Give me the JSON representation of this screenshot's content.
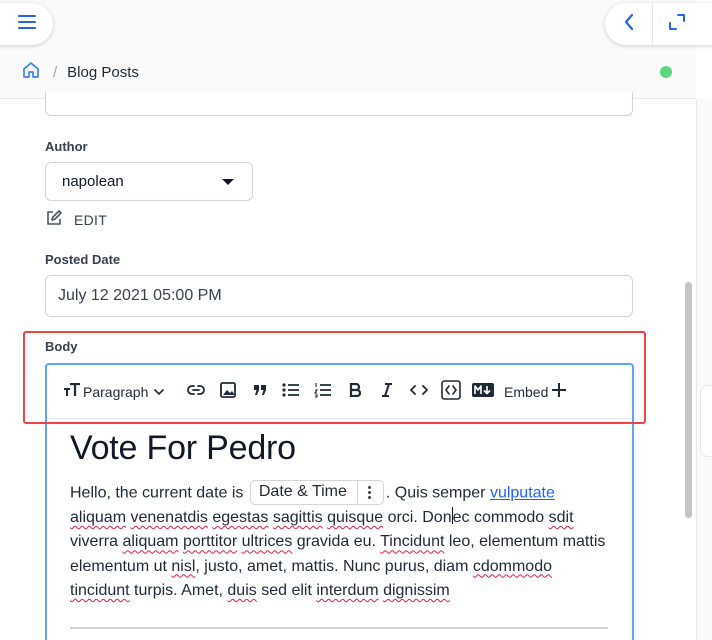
{
  "header": {
    "breadcrumb_separator": "/",
    "breadcrumb_current": "Blog Posts",
    "status_color": "#5ed67f"
  },
  "icons": {
    "menu": "hamburger-icon",
    "back": "chevron-left-icon",
    "expand": "expand-icon",
    "home": "home-icon",
    "edit": "pencil-square-icon"
  },
  "form": {
    "author": {
      "label": "Author",
      "value": "napolean",
      "edit_label": "EDIT"
    },
    "posted_date": {
      "label": "Posted Date",
      "value": "July 12 2021 05:00 PM"
    },
    "body": {
      "label": "Body"
    }
  },
  "editor": {
    "toolbar": {
      "paragraph_label": "Paragraph",
      "embed_label": "Embed",
      "buttons": [
        "text-style",
        "link",
        "image",
        "quote",
        "bulleted-list",
        "numbered-list",
        "bold",
        "italic",
        "code",
        "code-block",
        "markdown"
      ]
    },
    "content": {
      "heading": "Vote For Pedro",
      "p_intro": "Hello, the current date is ",
      "chip_label": "Date & Time",
      "p_after_chip": ". Quis semper ",
      "link_text": "vulputate",
      "w_aliquam": "aliquam",
      "w_venenatdis": "venenatdis",
      "w_egestas": "egestas",
      "w_sagittis": "sagittis",
      "w_quisque": "quisque",
      "t_orci": " orci. Don",
      "t_ec_commodo": "ec commodo ",
      "w_sdit": "sdit",
      "t_viverra": "viverra ",
      "w_aliquam2": "aliquam",
      "w_porttitor": "porttitor",
      "w_ultrices": "ultrices",
      "t_gravida": " gravida eu. ",
      "w_tincidunt": "Tincidunt",
      "t_leo": " leo, elementum mattis elementum ut ",
      "w_nisl": "nisl",
      "t_justo": ", justo, amet, mattis. Nunc purus, diam ",
      "w_cdommodo": "cdommodo",
      "w_tincidunt2": "tincidunt",
      "t_turpis": " turpis. Amet, ",
      "w_duis": "duis",
      "t_sed": " sed elit ",
      "w_interdum": "interdum",
      "w_dignissim": "dignissim"
    }
  },
  "colors": {
    "focus_border": "#60a5fa",
    "highlight": "#ef4444",
    "link": "#2563eb",
    "spellcheck": "#e11d48"
  }
}
